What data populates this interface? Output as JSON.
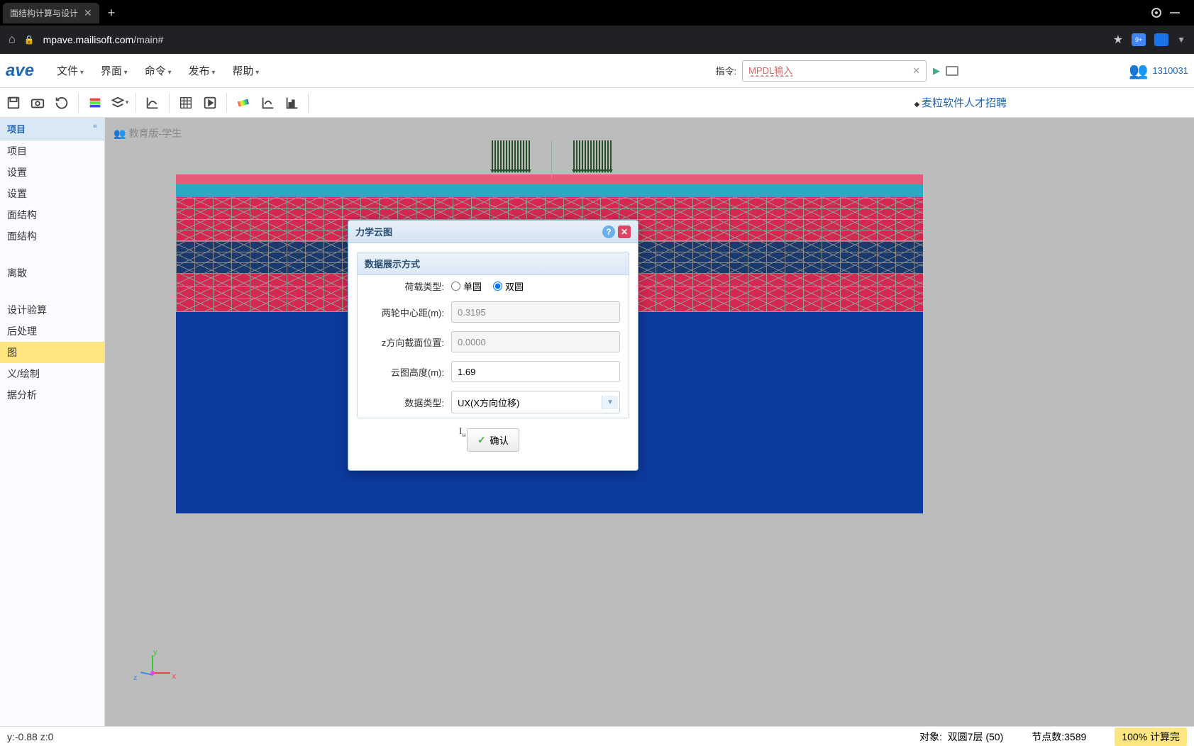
{
  "browser": {
    "tab_title": "面结构计算与设计",
    "url_domain": "mpave.mailisoft.com",
    "url_path": "/main#",
    "ext_badge": "9+"
  },
  "app": {
    "logo": "ave",
    "menu": [
      "文件",
      "界面",
      "命令",
      "发布",
      "帮助"
    ],
    "cmd_label": "指令:",
    "cmd_placeholder": "MPDL输入",
    "user_id": "1310031"
  },
  "recruit_link": "麦粒软件人才招聘",
  "sidebar": {
    "title": "项目",
    "items": [
      "项目",
      "设置",
      "设置",
      "面结构",
      "面结构",
      "",
      "离散",
      "",
      "设计验算",
      "后处理",
      "图",
      "义/绘制",
      "据分析"
    ],
    "selected_index": 10
  },
  "watermark": "教育版-学生",
  "dialog": {
    "title": "力学云图",
    "section_title": "数据展示方式",
    "load_type_label": "荷载类型:",
    "radio_single": "单圆",
    "radio_double": "双圆",
    "wheel_dist_label": "两轮中心距(m):",
    "wheel_dist_value": "0.3195",
    "z_section_label": "z方向截面位置:",
    "z_section_value": "0.0000",
    "height_label": "云图高度(m):",
    "height_value": "1.69",
    "data_type_label": "数据类型:",
    "data_type_value": "UX(X方向位移)",
    "ok_label": "确认"
  },
  "axis": {
    "x": "x",
    "y": "y",
    "z": "z"
  },
  "status": {
    "coords": "y:-0.88   z:0",
    "object_label": "对象:",
    "object_value": "双圆7层 (50)",
    "nodes_label": "节点数:",
    "nodes_value": "3589",
    "progress": "100% 计算完"
  }
}
